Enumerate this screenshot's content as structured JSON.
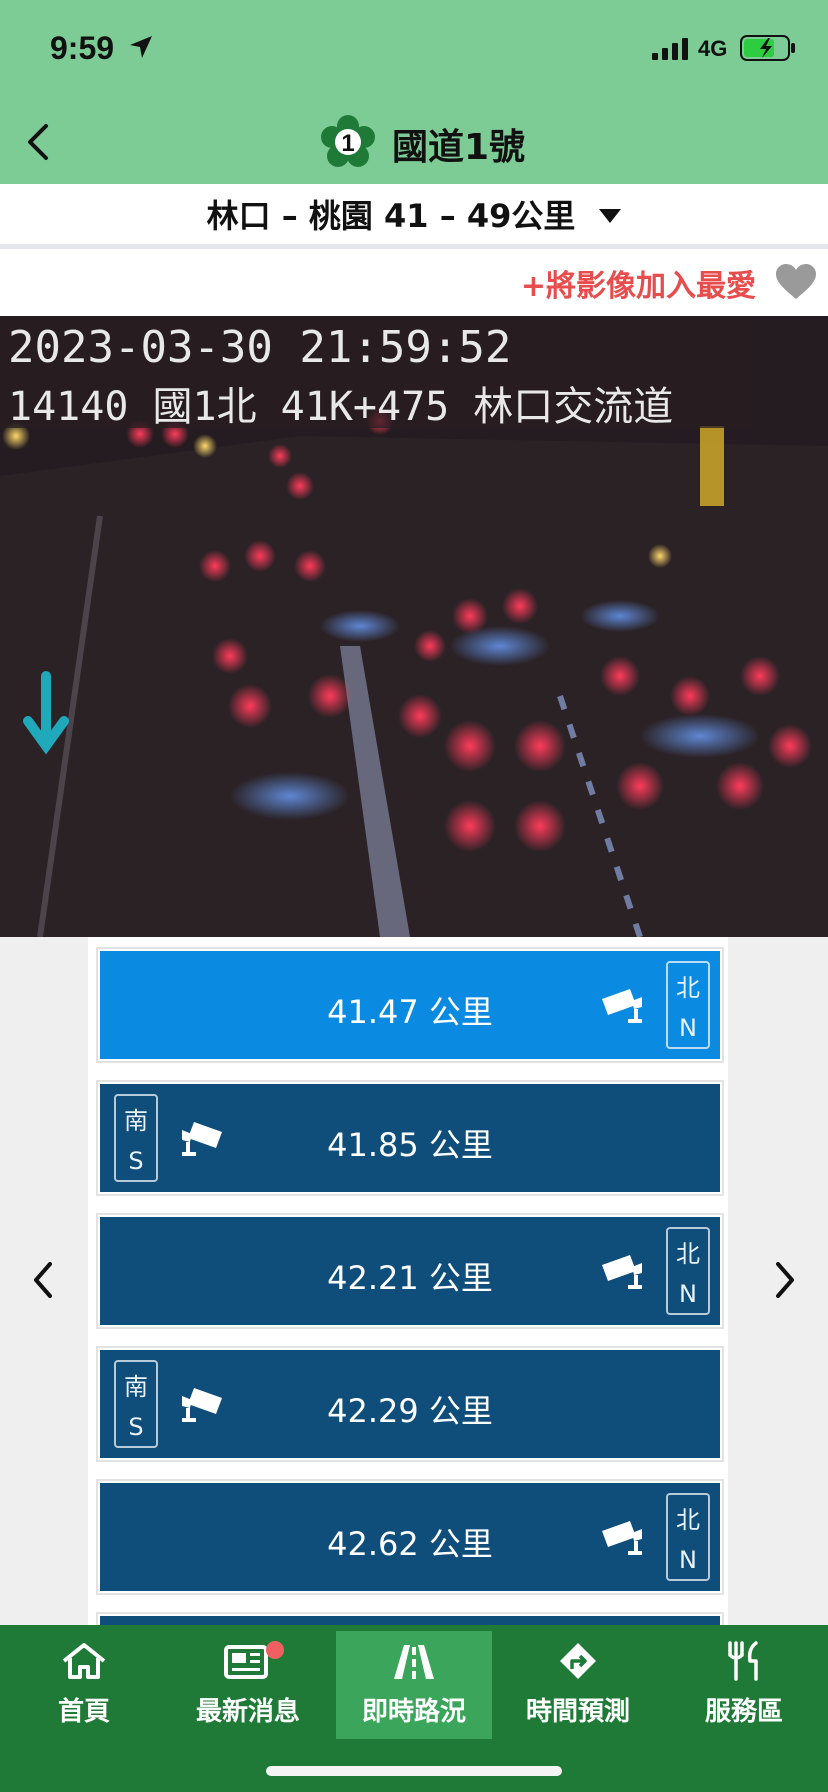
{
  "status": {
    "time": "9:59",
    "network": "4G"
  },
  "nav": {
    "route_number": "1",
    "title": "國道1號"
  },
  "section": {
    "label": "林口 – 桃園 41 – 49公里"
  },
  "favorite": {
    "label": "+將影像加入最愛"
  },
  "camera": {
    "timestamp": "2023-03-30 21:59:52",
    "location": "14140 國1北 41K+475 林口交流道"
  },
  "cameras": [
    {
      "km": "41.47 公里",
      "dir_cn": "北",
      "dir_en": "N",
      "side": "right",
      "active": true
    },
    {
      "km": "41.85 公里",
      "dir_cn": "南",
      "dir_en": "S",
      "side": "left",
      "active": false
    },
    {
      "km": "42.21 公里",
      "dir_cn": "北",
      "dir_en": "N",
      "side": "right",
      "active": false
    },
    {
      "km": "42.29 公里",
      "dir_cn": "南",
      "dir_en": "S",
      "side": "left",
      "active": false
    },
    {
      "km": "42.62 公里",
      "dir_cn": "北",
      "dir_en": "N",
      "side": "right",
      "active": false
    }
  ],
  "tabs": [
    {
      "label": "首頁",
      "icon": "home-icon"
    },
    {
      "label": "最新消息",
      "icon": "news-icon"
    },
    {
      "label": "即時路況",
      "icon": "road-icon"
    },
    {
      "label": "時間預測",
      "icon": "route-icon"
    },
    {
      "label": "服務區",
      "icon": "service-area-icon"
    }
  ],
  "colors": {
    "header": "#7dcb95",
    "camera_item": "#0f4d7a",
    "camera_item_active": "#0a8ae0",
    "tab_bar": "#1f7a37",
    "favorite_text": "#e84d4d"
  }
}
